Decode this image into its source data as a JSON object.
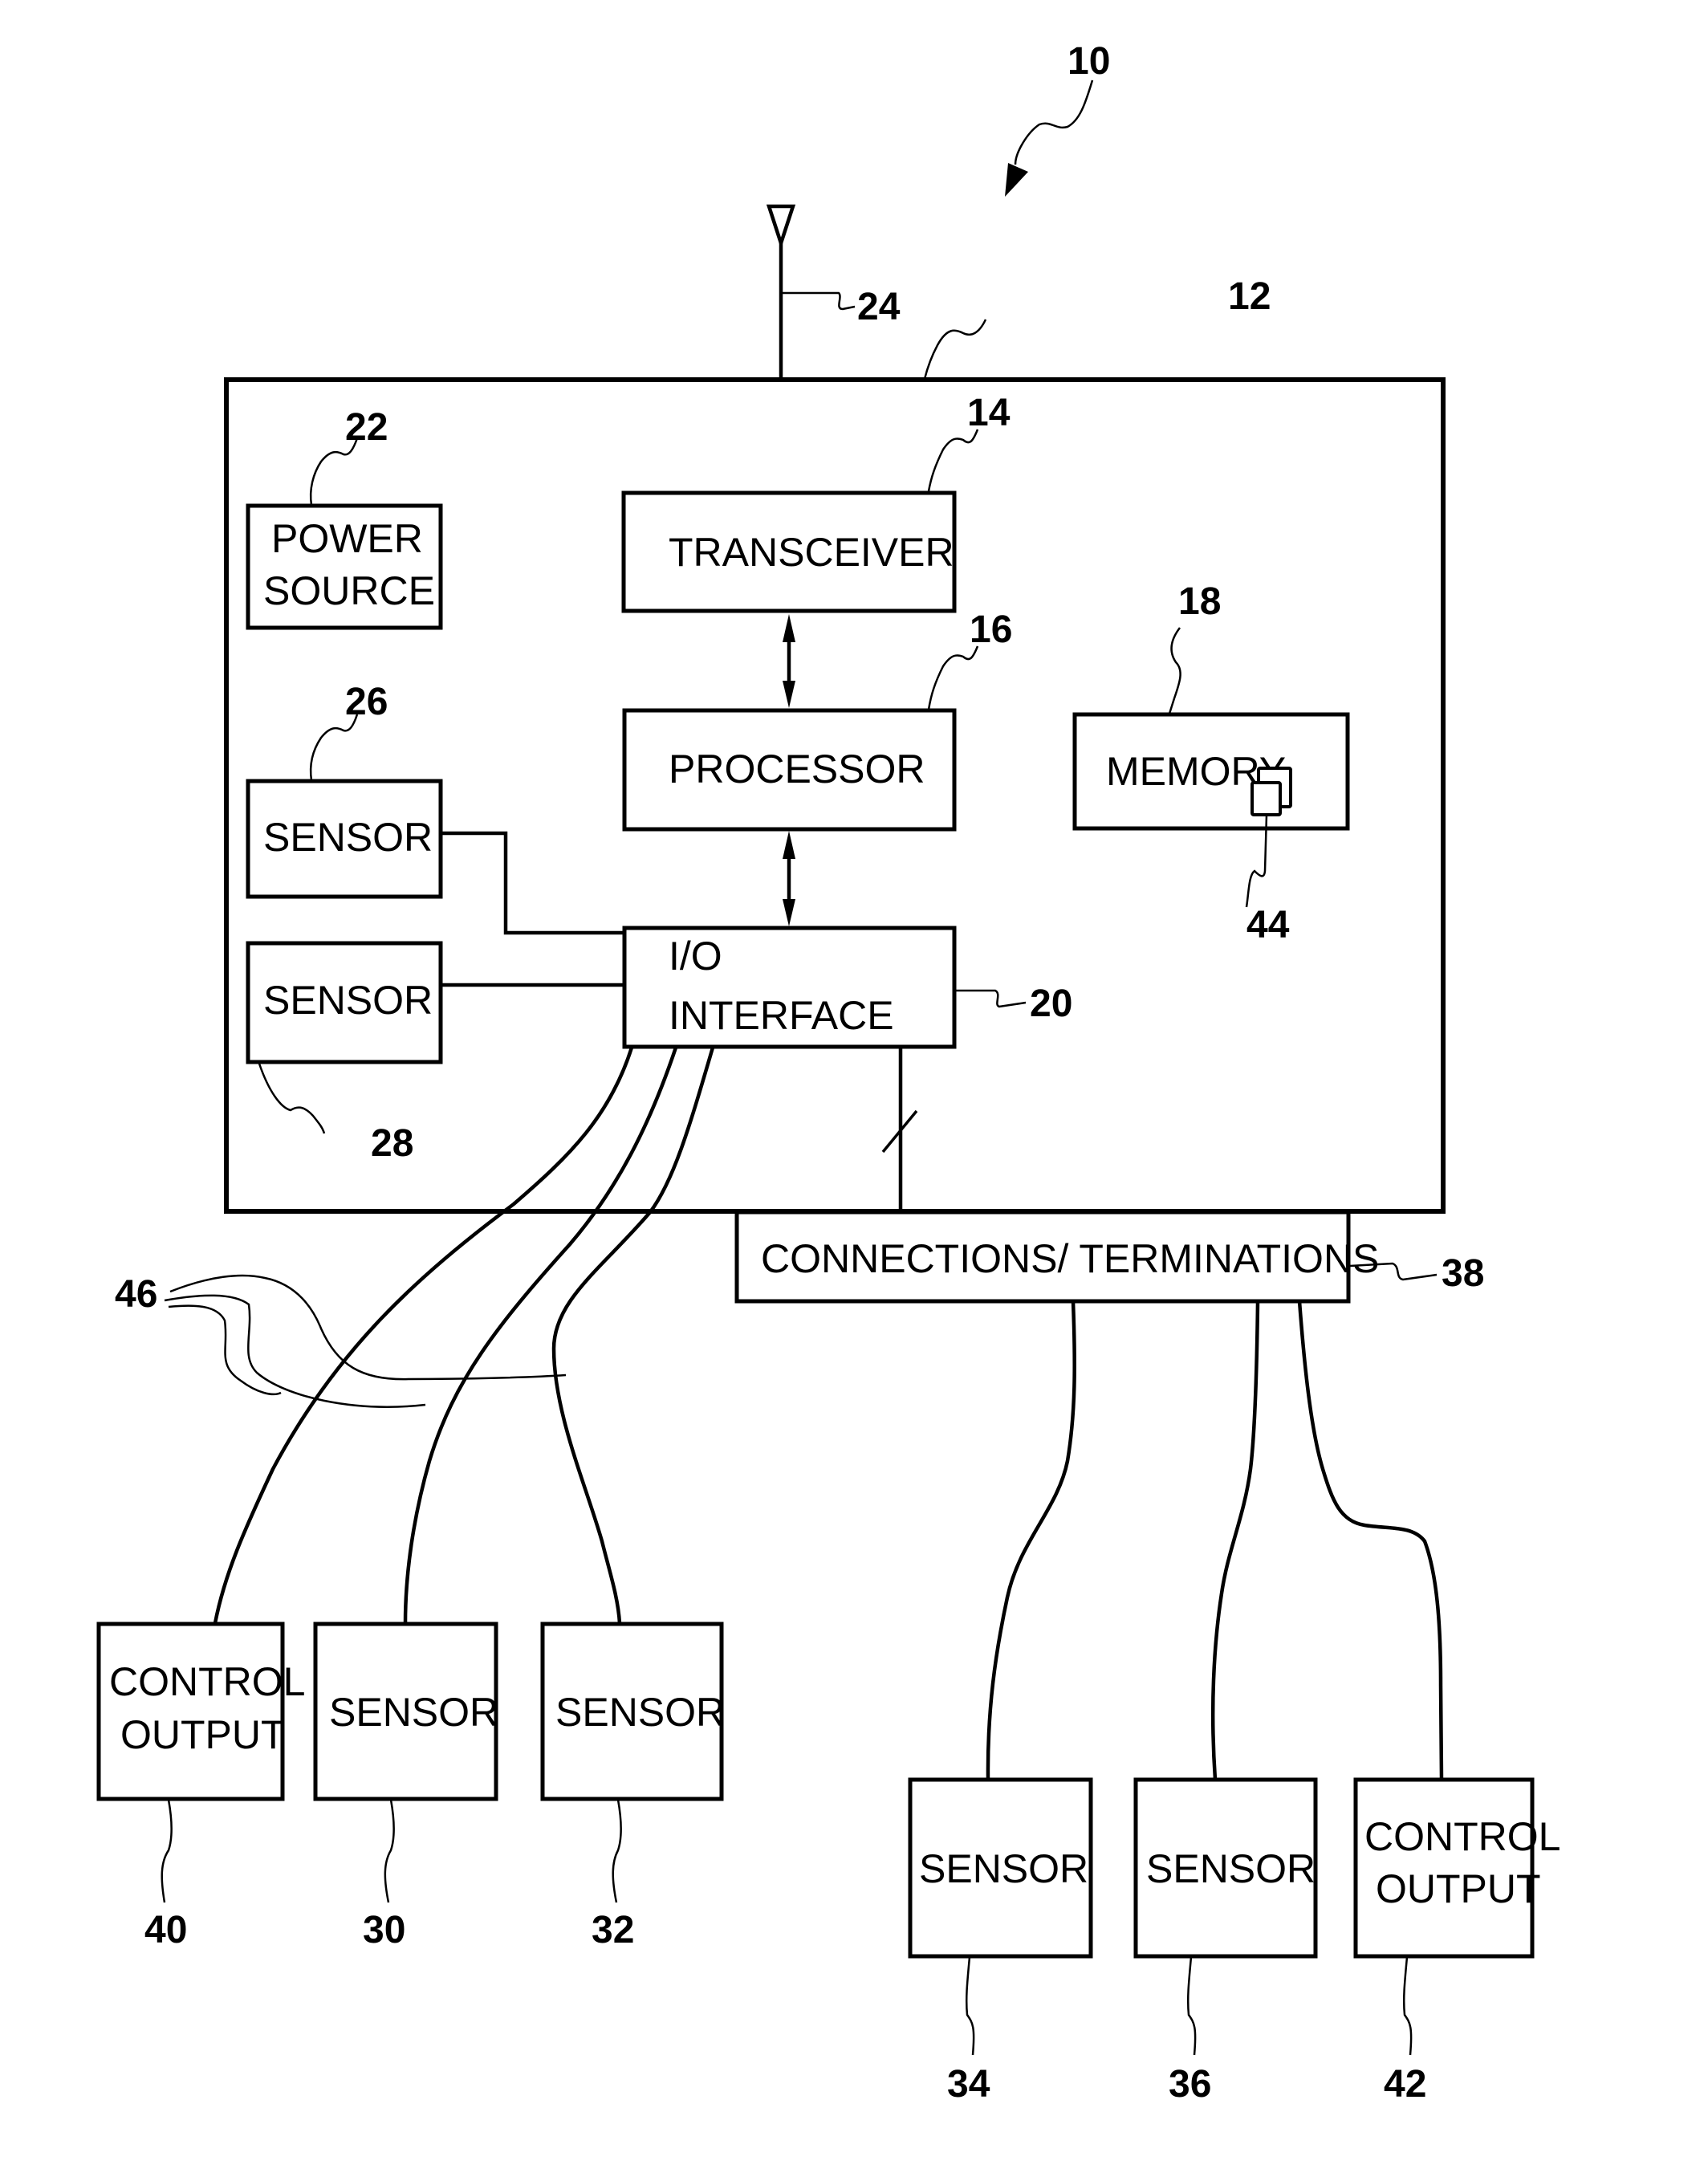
{
  "figure": {
    "overall_ref": "10",
    "device_ref": "12",
    "antenna_ref": "24",
    "colors": {
      "ink": "#000000",
      "paper": "#ffffff"
    }
  },
  "blocks": {
    "transceiver": {
      "label": "TRANSCEIVER",
      "ref": "14"
    },
    "processor": {
      "label": "PROCESSOR",
      "ref": "16"
    },
    "memory": {
      "label": "MEMORY",
      "ref": "18",
      "inner_ref": "44"
    },
    "io_interface": {
      "label_line1": "I/O",
      "label_line2": "INTERFACE",
      "ref": "20"
    },
    "power_source": {
      "label_line1": "POWER",
      "label_line2": "SOURCE",
      "ref": "22"
    },
    "internal_sensor_1": {
      "label": "SENSOR",
      "ref": "26"
    },
    "internal_sensor_2": {
      "label": "SENSOR",
      "ref": "28"
    },
    "connections": {
      "label": "CONNECTIONS/ TERMINATIONS",
      "ref": "38"
    }
  },
  "external_left": [
    {
      "label_line1": "CONTROL",
      "label_line2": "OUTPUT",
      "ref": "40"
    },
    {
      "label_line1": "SENSOR",
      "label_line2": "",
      "ref": "30"
    },
    {
      "label_line1": "SENSOR",
      "label_line2": "",
      "ref": "32"
    }
  ],
  "external_right": [
    {
      "label_line1": "SENSOR",
      "label_line2": "",
      "ref": "34"
    },
    {
      "label_line1": "SENSOR",
      "label_line2": "",
      "ref": "36"
    },
    {
      "label_line1": "CONTROL",
      "label_line2": "OUTPUT",
      "ref": "42"
    }
  ],
  "wires_ref": "46"
}
